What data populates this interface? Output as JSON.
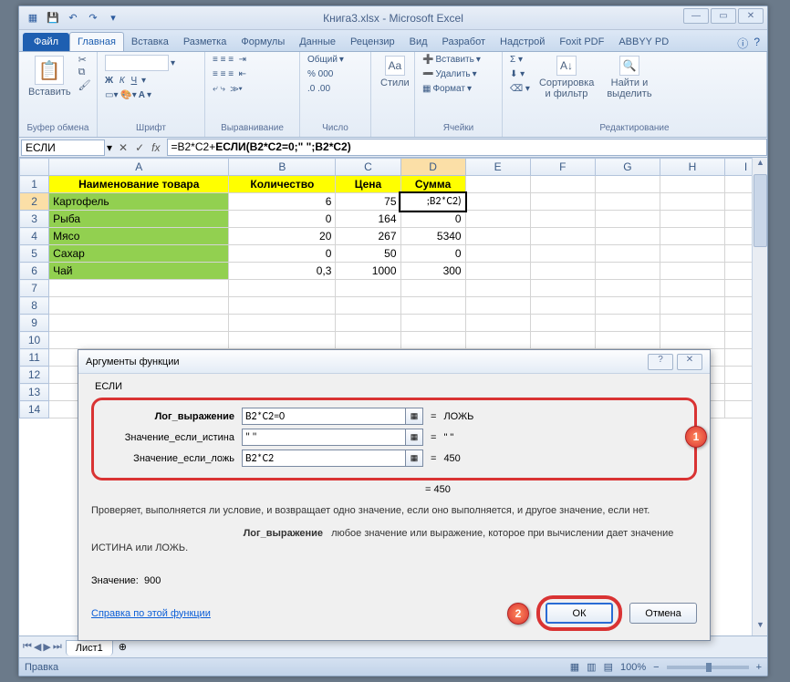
{
  "window": {
    "title": "Книга3.xlsx - Microsoft Excel"
  },
  "tabs": {
    "file": "Файл",
    "items": [
      "Главная",
      "Вставка",
      "Разметка",
      "Формулы",
      "Данные",
      "Рецензир",
      "Вид",
      "Разработ",
      "Надстрой",
      "Foxit PDF",
      "ABBYY PD"
    ],
    "active_index": 0
  },
  "ribbon": {
    "paste": "Вставить",
    "clipboard": "Буфер обмена",
    "font": "Шрифт",
    "alignment": "Выравнивание",
    "number": "Число",
    "number_format": "Общий",
    "styles": "Стили",
    "cells": "Ячейки",
    "insert": "Вставить",
    "delete": "Удалить",
    "format": "Формат",
    "editing": "Редактирование",
    "sort": "Сортировка и фильтр",
    "find": "Найти и выделить"
  },
  "formula_bar": {
    "name_box": "ЕСЛИ",
    "formula_prefix": "=B2*C2+",
    "formula_bold": "ЕСЛИ(B2*C2=0;\" \";B2*C2)"
  },
  "columns": [
    "A",
    "B",
    "C",
    "D",
    "E",
    "F",
    "G",
    "H",
    "I"
  ],
  "headers": {
    "name": "Наименование товара",
    "qty": "Количество",
    "price": "Цена",
    "sum": "Сумма"
  },
  "rows": [
    {
      "n": "2",
      "name": "Картофель",
      "qty": "6",
      "price": "75",
      "sum": ";B2*C2)"
    },
    {
      "n": "3",
      "name": "Рыба",
      "qty": "0",
      "price": "164",
      "sum": "0"
    },
    {
      "n": "4",
      "name": "Мясо",
      "qty": "20",
      "price": "267",
      "sum": "5340"
    },
    {
      "n": "5",
      "name": "Сахар",
      "qty": "0",
      "price": "50",
      "sum": "0"
    },
    {
      "n": "6",
      "name": "Чай",
      "qty": "0,3",
      "price": "1000",
      "sum": "300"
    }
  ],
  "empty_rows": [
    "7",
    "8",
    "9",
    "10",
    "11",
    "12",
    "13",
    "14"
  ],
  "sheet_tab": "Лист1",
  "status": {
    "mode": "Правка",
    "zoom": "100%"
  },
  "dialog": {
    "title": "Аргументы функции",
    "fname": "ЕСЛИ",
    "args": [
      {
        "label": "Лог_выражение",
        "bold": true,
        "value": "B2*C2=0",
        "result": "ЛОЖЬ"
      },
      {
        "label": "Значение_если_истина",
        "bold": false,
        "value": "\" \"",
        "result": "\" \""
      },
      {
        "label": "Значение_если_ложь",
        "bold": false,
        "value": "B2*C2",
        "result": "450"
      }
    ],
    "eq": "=",
    "overall_result": "=   450",
    "desc1": "Проверяет, выполняется ли условие, и возвращает одно значение, если оно выполняется, и другое значение, если нет.",
    "desc2_label": "Лог_выражение",
    "desc2_text": "любое значение или выражение, которое при вычислении дает значение ИСТИНА или ЛОЖЬ.",
    "value_label": "Значение:",
    "value": "900",
    "help_link": "Справка по этой функции",
    "ok": "ОК",
    "cancel": "Отмена",
    "callout1": "1",
    "callout2": "2"
  }
}
